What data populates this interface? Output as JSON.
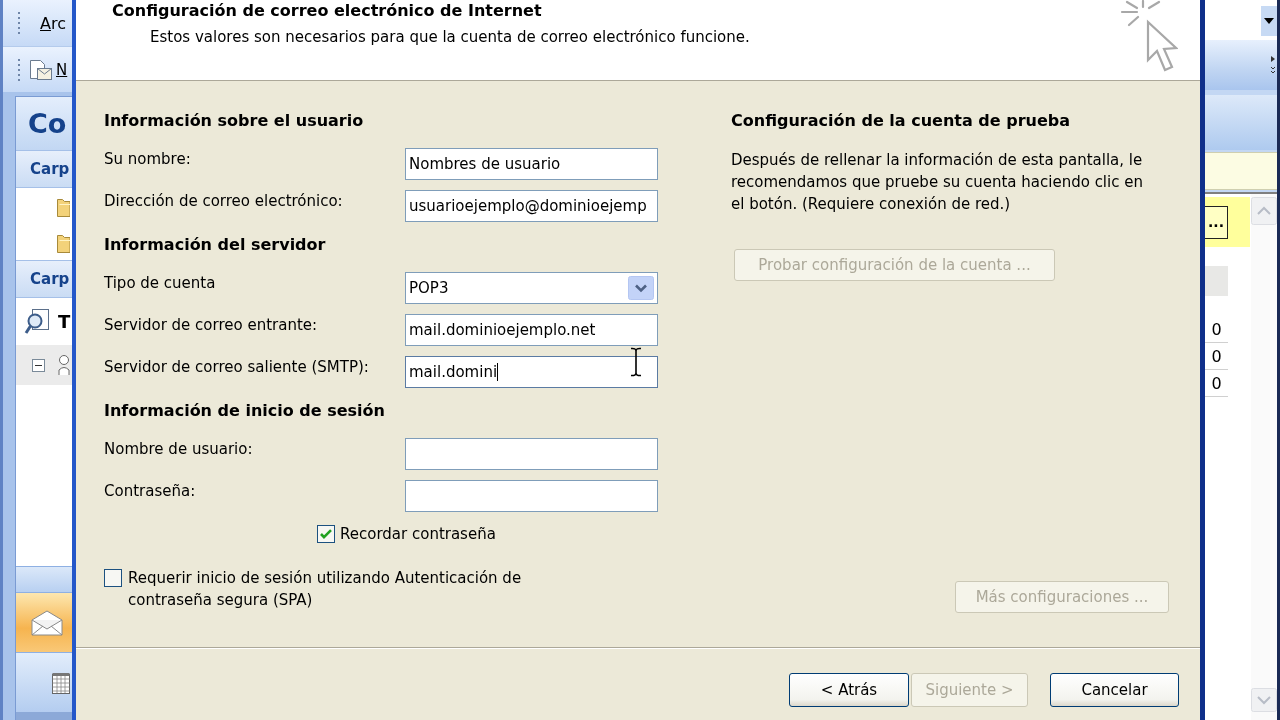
{
  "outlook": {
    "menu_bar": {
      "item": "Arc"
    },
    "toolbar": {
      "button": "N"
    },
    "navigation_pane": {
      "title": "Co",
      "sections": [
        {
          "title": "Carp",
          "items": [
            {
              "kind": "folder"
            },
            {
              "kind": "folder"
            }
          ]
        },
        {
          "title": "Carp",
          "items": [
            {
              "kind": "search_folder",
              "label": "T"
            },
            {
              "kind": "tree_node",
              "expanded": true
            }
          ]
        }
      ],
      "buttons": [
        {
          "kind": "mail",
          "selected": true
        },
        {
          "kind": "calendar",
          "selected": false
        }
      ]
    },
    "side_pane": {
      "info_bar_button": "...",
      "counts": [
        "0",
        "0",
        "0"
      ]
    }
  },
  "dialog": {
    "title": "Configuración de correo electrónico de Internet",
    "subtitle": "Estos valores son necesarios para que la cuenta de correo electrónico funcione.",
    "sections": [
      {
        "title": "Información sobre el usuario",
        "fields": [
          {
            "label": "Su nombre:",
            "kind": "text",
            "value": "Nombres de usuario",
            "focused": false
          },
          {
            "label": "Dirección de correo electrónico:",
            "kind": "text",
            "value": "usuarioejemplo@dominioejemp",
            "focused": false
          }
        ]
      },
      {
        "title": "Información del servidor",
        "fields": [
          {
            "label": "Tipo de cuenta",
            "kind": "dropdown",
            "value": "POP3",
            "focused": false
          },
          {
            "label": "Servidor de correo entrante:",
            "kind": "text",
            "value": "mail.dominioejemplo.net",
            "focused": false
          },
          {
            "label": "Servidor de correo saliente (SMTP):",
            "kind": "text",
            "value": "mail.domini",
            "focused": true
          }
        ]
      },
      {
        "title": "Información de inicio de sesión",
        "fields": [
          {
            "label": "Nombre de usuario:",
            "kind": "text",
            "focused": false
          },
          {
            "label": "Contraseña:",
            "kind": "text",
            "focused": false
          }
        ]
      }
    ],
    "remember_password": {
      "label": "Recordar contraseña",
      "checked": true
    },
    "secure_authentication": {
      "label": "Requerir inicio de sesión utilizando Autenticación de contraseña segura (SPA)",
      "checked": false
    },
    "test_settings": {
      "title": "Configuración de la cuenta de prueba",
      "description": "Después de rellenar la información de esta pantalla, le recomendamos que pruebe su cuenta haciendo clic en el botón. (Requiere conexión de red.)",
      "button": {
        "label": "Probar configuración de la cuenta ...",
        "disabled": true
      }
    },
    "more_settings_button": {
      "label": "Más configuraciones ...",
      "disabled": true
    },
    "buttons": [
      {
        "label": "< Atrás",
        "disabled": false
      },
      {
        "label": "Siguiente >",
        "disabled": true
      },
      {
        "label": "Cancelar",
        "disabled": false
      }
    ]
  }
}
